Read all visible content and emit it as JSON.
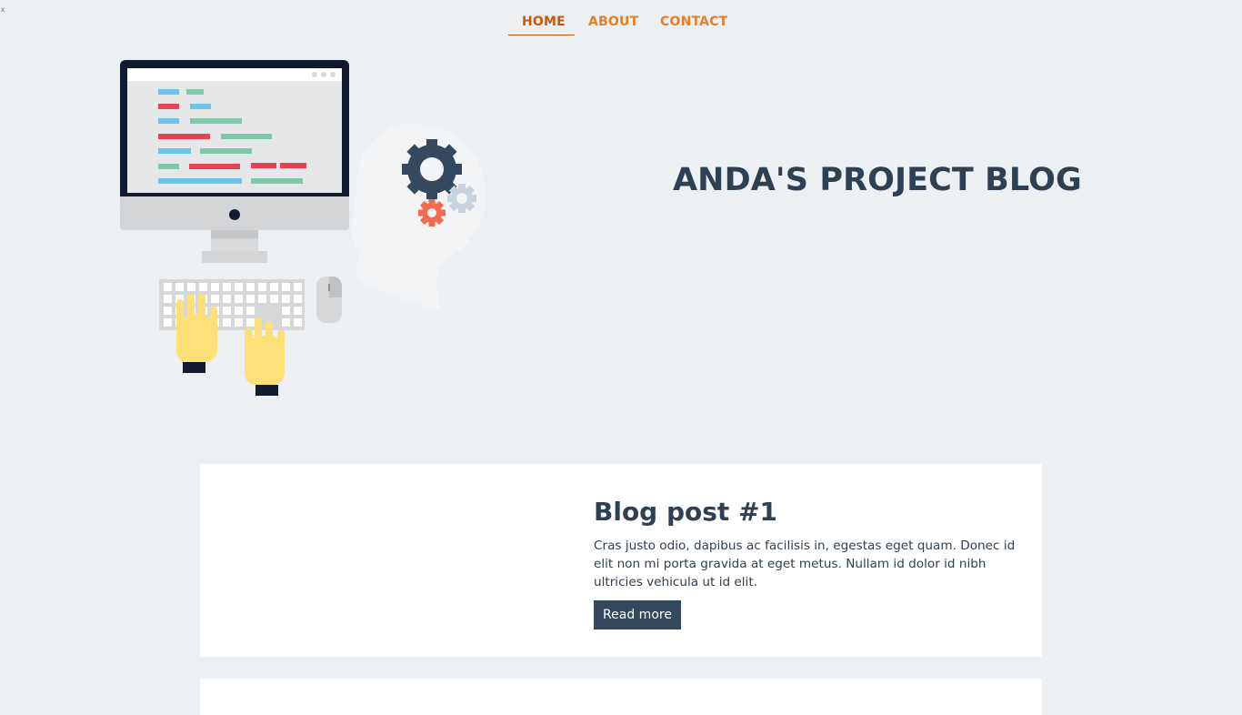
{
  "corner_glyph": "x",
  "nav": {
    "items": [
      {
        "label": "HOME",
        "active": true
      },
      {
        "label": "ABOUT",
        "active": false
      },
      {
        "label": "CONTACT",
        "active": false
      }
    ]
  },
  "hero": {
    "title": "ANDA'S PROJECT BLOG",
    "illustration": "developer-workstation-illustration"
  },
  "posts": [
    {
      "title": "Blog post #1",
      "excerpt": "Cras justo odio, dapibus ac facilisis in, egestas eget quam. Donec id elit non mi porta gravida at eget metus. Nullam id dolor id nibh ultricies vehicula ut id elit.",
      "read_more_label": "Read more"
    }
  ],
  "colors": {
    "background": "#edf0f2",
    "nav_link": "#e67e22",
    "nav_active": "#d35400",
    "heading": "#2e4053",
    "button": "#34495e"
  }
}
